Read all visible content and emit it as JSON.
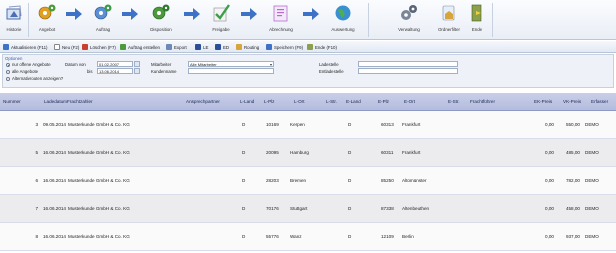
{
  "ribbon": {
    "buttons": [
      {
        "label": "Historie",
        "icon": "history-icon",
        "color": "#4a6fb5"
      },
      {
        "label": "Angebot",
        "icon": "offer-gears-icon",
        "color": "#e0a020"
      },
      {
        "label": "Auftrag",
        "icon": "order-gears-icon",
        "color": "#5a8fd6"
      },
      {
        "label": "Disposition",
        "icon": "disposition-gears-icon",
        "color": "#4c9a3c"
      },
      {
        "label": "Freigabe",
        "icon": "release-check-icon",
        "color": "#3aa04a"
      },
      {
        "label": "Abrechnung",
        "icon": "billing-icon",
        "color": "#b86ad0"
      },
      {
        "label": "Auswertung",
        "icon": "evaluation-globe-icon",
        "color": "#3a8fd0"
      },
      {
        "label": "Verwaltung",
        "icon": "administration-gears-icon",
        "color": "#6a7688"
      },
      {
        "label": "Ordnerfilter",
        "icon": "folder-filter-icon",
        "color": "#d8a53a"
      },
      {
        "label": "Ende",
        "icon": "exit-door-icon",
        "color": "#6a8a3a"
      }
    ]
  },
  "toolbar": {
    "items": [
      "Aktualisieren (F11)",
      "Neu (F2)",
      "Löschen (F7)",
      "Auftrag erstellen",
      "Export",
      "LE",
      "ED",
      "Routing",
      "Speichern (F9)",
      "Ende (F10)"
    ]
  },
  "filter": {
    "heading": "Optionen",
    "radios": [
      {
        "label": "nur offene Angebote",
        "checked": true
      },
      {
        "label": "alle Angebote",
        "checked": false
      },
      {
        "label": "Alternativrouten anzeigen?",
        "checked": false
      }
    ],
    "datum_von_label": "Datum von",
    "datum_von_value": "01.02.2007",
    "bis_label": "bis",
    "bis_value": "13.06.2014",
    "mitarbeiter_label": "Mitarbeiter",
    "mitarbeiter_value": "Alle Mitarbeiter",
    "kundenname_label": "Kundenname",
    "kundenname_value": "",
    "ladestelle_label": "Ladestelle",
    "ladestelle_value": "",
    "entladestelle_label": "Entladestelle",
    "entladestelle_value": ""
  },
  "grid": {
    "columns": [
      "Nummer",
      "Ladedatum",
      "Frachtzahler",
      "Ansprechpartner",
      "L-Land",
      "L-Plz",
      "L-Ort",
      "L-Str.",
      "E-Land",
      "E-Plz",
      "E-Ort",
      "E-Str.",
      "Frachtführer",
      "EK-Preis",
      "VK-Preis",
      "Erfasser"
    ],
    "rows": [
      {
        "nummer": "3",
        "ladedatum": "09.05.2014",
        "frachtzahler": "Musterkunde GmbH & Co. KG",
        "ansprechpartner": "",
        "l_land": "D",
        "l_plz": "10169",
        "l_ort": "Kerpen",
        "l_str": "",
        "e_land": "D",
        "e_plz": "60313",
        "e_ort": "Frankfurt",
        "e_str": "",
        "frachtfuehrer": "",
        "ek": "0,00",
        "vk": "550,00",
        "erfasser": "DEMO"
      },
      {
        "nummer": "5",
        "ladedatum": "16.06.2014",
        "frachtzahler": "Musterkunde GmbH & Co. KG",
        "ansprechpartner": "",
        "l_land": "D",
        "l_plz": "20095",
        "l_ort": "Hamburg",
        "l_str": "",
        "e_land": "D",
        "e_plz": "60311",
        "e_ort": "Frankfurt",
        "e_str": "",
        "frachtfuehrer": "",
        "ek": "0,00",
        "vk": "485,00",
        "erfasser": "DEMO"
      },
      {
        "nummer": "6",
        "ladedatum": "16.06.2014",
        "frachtzahler": "Musterkunde GmbH & Co. KG",
        "ansprechpartner": "",
        "l_land": "D",
        "l_plz": "28203",
        "l_ort": "Bremen",
        "l_str": "",
        "e_land": "D",
        "e_plz": "85250",
        "e_ort": "Altomünster",
        "e_str": "",
        "frachtfuehrer": "",
        "ek": "0,00",
        "vk": "782,00",
        "erfasser": "DEMO"
      },
      {
        "nummer": "7",
        "ladedatum": "16.06.2014",
        "frachtzahler": "Musterkunde GmbH & Co. KG",
        "ansprechpartner": "",
        "l_land": "D",
        "l_plz": "70176",
        "l_ort": "Stuttgart",
        "l_str": "",
        "e_land": "D",
        "e_plz": "87338",
        "e_ort": "Altenbeuthen",
        "e_str": "",
        "frachtfuehrer": "",
        "ek": "0,00",
        "vk": "458,00",
        "erfasser": "DEMO"
      },
      {
        "nummer": "8",
        "ladedatum": "16.06.2014",
        "frachtzahler": "Musterkunde GmbH & Co. KG",
        "ansprechpartner": "",
        "l_land": "D",
        "l_plz": "55776",
        "l_ort": "Wanz",
        "l_str": "",
        "e_land": "D",
        "e_plz": "12109",
        "e_ort": "Berlin",
        "e_str": "",
        "frachtfuehrer": "",
        "ek": "0,00",
        "vk": "937,00",
        "erfasser": "DEMO"
      }
    ]
  }
}
